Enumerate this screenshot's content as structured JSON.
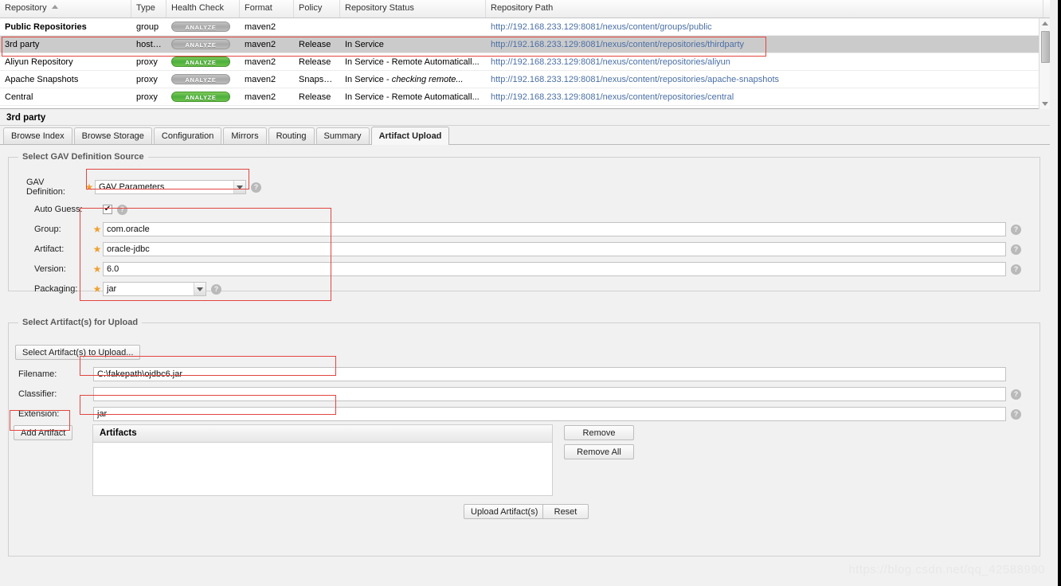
{
  "repo_grid": {
    "columns": [
      "Repository",
      "Type",
      "Health Check",
      "Format",
      "Policy",
      "Repository Status",
      "Repository Path"
    ],
    "sort_column": "Repository",
    "sort_direction": "asc",
    "health_button_label": "ANALYZE",
    "rows": [
      {
        "repository": "Public Repositories",
        "type": "group",
        "health": "ANALYZE",
        "health_state": "gray",
        "format": "maven2",
        "policy": "",
        "status": "",
        "status_italic": "",
        "path": "http://192.168.233.129:8081/nexus/content/groups/public",
        "selected": false
      },
      {
        "repository": "3rd party",
        "type": "hosted",
        "health": "ANALYZE",
        "health_state": "gray",
        "format": "maven2",
        "policy": "Release",
        "status": "In Service",
        "status_italic": "",
        "path": "http://192.168.233.129:8081/nexus/content/repositories/thirdparty",
        "selected": true
      },
      {
        "repository": "Aliyun Repository",
        "type": "proxy",
        "health": "ANALYZE",
        "health_state": "green",
        "format": "maven2",
        "policy": "Release",
        "status": "In Service - Remote Automaticall...",
        "status_italic": "",
        "path": "http://192.168.233.129:8081/nexus/content/repositories/aliyun",
        "selected": false
      },
      {
        "repository": "Apache Snapshots",
        "type": "proxy",
        "health": "ANALYZE",
        "health_state": "gray",
        "format": "maven2",
        "policy": "Snapshot",
        "status": "In Service - ",
        "status_italic": "checking remote...",
        "path": "http://192.168.233.129:8081/nexus/content/repositories/apache-snapshots",
        "selected": false
      },
      {
        "repository": "Central",
        "type": "proxy",
        "health": "ANALYZE",
        "health_state": "green",
        "format": "maven2",
        "policy": "Release",
        "status": "In Service - Remote Automaticall...",
        "status_italic": "",
        "path": "http://192.168.233.129:8081/nexus/content/repositories/central",
        "selected": false
      }
    ]
  },
  "detail": {
    "title": "3rd party",
    "tabs": [
      {
        "label": "Browse Index",
        "active": false
      },
      {
        "label": "Browse Storage",
        "active": false
      },
      {
        "label": "Configuration",
        "active": false
      },
      {
        "label": "Mirrors",
        "active": false
      },
      {
        "label": "Routing",
        "active": false
      },
      {
        "label": "Summary",
        "active": false
      },
      {
        "label": "Artifact Upload",
        "active": true
      }
    ]
  },
  "gav_section": {
    "legend": "Select GAV Definition Source",
    "gav_definition_label": "GAV Definition:",
    "gav_definition_value": "GAV Parameters",
    "auto_guess_label": "Auto Guess:",
    "auto_guess_checked": true,
    "group_label": "Group:",
    "group_value": "com.oracle",
    "artifact_label": "Artifact:",
    "artifact_value": "oracle-jdbc",
    "version_label": "Version:",
    "version_value": "6.0",
    "packaging_label": "Packaging:",
    "packaging_value": "jar",
    "help_glyph": "?",
    "required_glyph": "★",
    "check_glyph": "✔"
  },
  "artifact_section": {
    "legend": "Select Artifact(s) for Upload",
    "select_button_label": "Select Artifact(s) to Upload...",
    "filename_label": "Filename:",
    "filename_value": "C:\\fakepath\\ojdbc6.jar",
    "classifier_label": "Classifier:",
    "classifier_value": "",
    "extension_label": "Extension:",
    "extension_value": "jar",
    "add_artifact_label": "Add Artifact",
    "artifacts_header": "Artifacts",
    "artifacts_rows": [],
    "remove_label": "Remove",
    "remove_all_label": "Remove All",
    "upload_label": "Upload Artifact(s)",
    "reset_label": "Reset",
    "help_glyph": "?"
  },
  "watermark": "https://blog.csdn.net/qq_42588990",
  "colors": {
    "annotation": "#e2453f",
    "health_green": "#4caf3e",
    "health_gray": "#a8a8a8",
    "link": "#4a6fa5",
    "selected_row": "#cbcbcb",
    "required_star": "#f0a030"
  }
}
